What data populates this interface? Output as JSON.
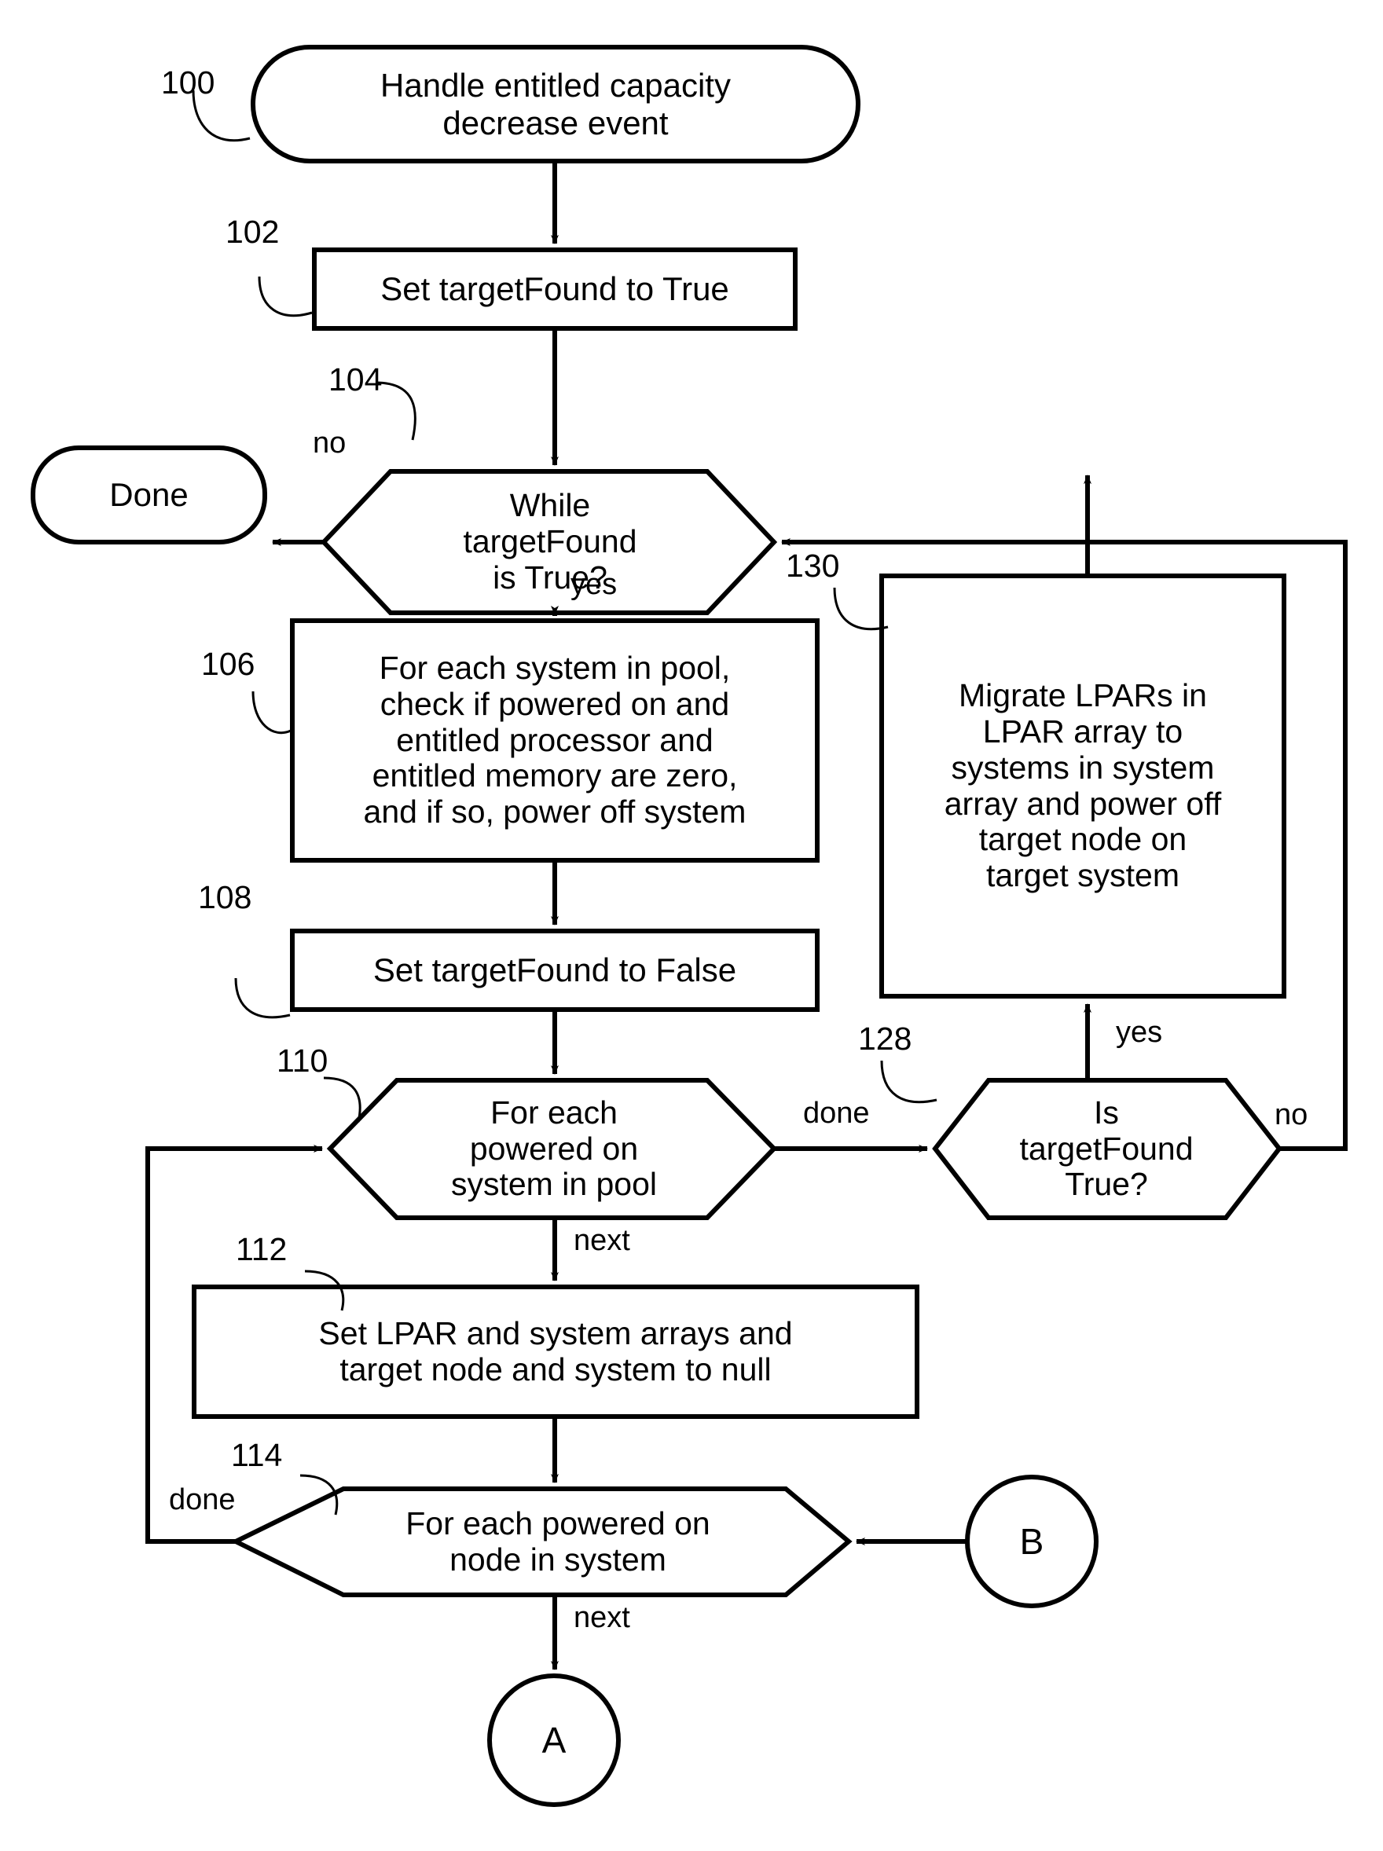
{
  "figure": {
    "type": "flowchart",
    "title": "Handle entitled capacity decrease event"
  },
  "nodes": {
    "start": {
      "ref": "100",
      "shape": "terminator",
      "text": "Handle entitled capacity\ndecrease event"
    },
    "set_true": {
      "ref": "102",
      "shape": "process",
      "text": "Set targetFound to True"
    },
    "while_loop": {
      "ref": "104",
      "shape": "hexagon",
      "text": "While\ntargetFound\nis True?"
    },
    "done": {
      "ref": "",
      "shape": "terminator",
      "text": "Done"
    },
    "check_systems": {
      "ref": "106",
      "shape": "process",
      "text": "For each system in pool,\ncheck if powered on and\nentitled processor and\nentitled memory are zero,\nand if so, power off system"
    },
    "set_false": {
      "ref": "108",
      "shape": "process",
      "text": "Set targetFound to False"
    },
    "for_each_system": {
      "ref": "110",
      "shape": "hexagon",
      "text": "For each\npowered on\nsystem in pool"
    },
    "set_arrays_null": {
      "ref": "112",
      "shape": "process",
      "text": "Set LPAR and system arrays and\ntarget node and system to null"
    },
    "for_each_node": {
      "ref": "114",
      "shape": "hexagon",
      "text": "For each powered on\nnode in system"
    },
    "is_target_found": {
      "ref": "128",
      "shape": "hexagon",
      "text": "Is\ntargetFound\nTrue?"
    },
    "migrate": {
      "ref": "130",
      "shape": "process",
      "text": "Migrate  LPARs in\nLPAR array to\nsystems in system\narray and power off\ntarget node on\ntarget system"
    },
    "connector_a": {
      "ref": "",
      "shape": "connector",
      "text": "A"
    },
    "connector_b": {
      "ref": "",
      "shape": "connector",
      "text": "B"
    }
  },
  "edge_labels": {
    "while_no": "no",
    "while_yes": "yes",
    "system_done": "done",
    "system_next": "next",
    "node_done": "done",
    "node_next": "next",
    "target_yes": "yes",
    "target_no": "no"
  },
  "colors": {
    "stroke": "#000000",
    "fill": "#ffffff",
    "text": "#000000"
  }
}
